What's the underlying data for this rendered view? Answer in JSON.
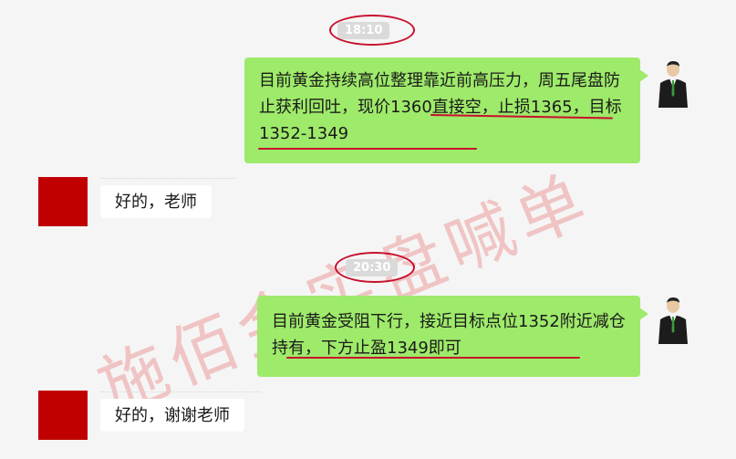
{
  "messages": [
    {
      "time": "18:10",
      "text": "目前黄金持续高位整理靠近前高压力，周五尾盘防止获利回吐，现价1360直接空，止损1365，目标1352-1349"
    },
    {
      "reply": "好的，老师"
    },
    {
      "time": "20:30",
      "text": "目前黄金受阻下行，接近目标点位1352附近减仓持有，下方止盈1349即可"
    },
    {
      "reply": "好的，谢谢老师"
    }
  ],
  "watermark": "施佰金实盘喊单",
  "colors": {
    "bubble": "#9eea6a",
    "avatar_red": "#c00000",
    "annotation": "#c8102e"
  }
}
